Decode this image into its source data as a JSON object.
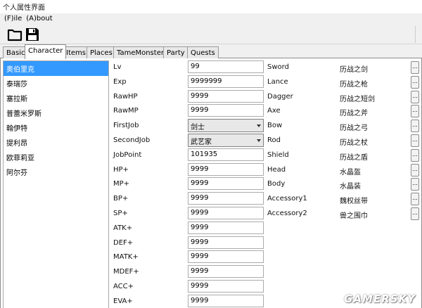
{
  "window": {
    "title": "个人属性界面"
  },
  "menu": [
    {
      "label": "(F)ile"
    },
    {
      "label": "(A)bout"
    }
  ],
  "toolbar": {
    "open_icon": "folder-icon",
    "save_icon": "floppy-disk-icon"
  },
  "tabs": [
    {
      "label": "Basic"
    },
    {
      "label": "Character",
      "active": true
    },
    {
      "label": "Items"
    },
    {
      "label": "Places"
    },
    {
      "label": "TameMonster"
    },
    {
      "label": "Party"
    },
    {
      "label": "Quests"
    }
  ],
  "characters": [
    {
      "name": "奥伯里克",
      "selected": true
    },
    {
      "name": "泰瑞莎"
    },
    {
      "name": "塞拉斯"
    },
    {
      "name": "普蕾米罗斯"
    },
    {
      "name": "翰伊特"
    },
    {
      "name": "提利昂"
    },
    {
      "name": "欧菲莉亚"
    },
    {
      "name": "阿尔芬"
    }
  ],
  "stats": [
    {
      "label": "Lv",
      "value": "99",
      "kind": "text"
    },
    {
      "label": "Exp",
      "value": "9999999",
      "kind": "text"
    },
    {
      "label": "RawHP",
      "value": "9999",
      "kind": "text"
    },
    {
      "label": "RawMP",
      "value": "9999",
      "kind": "text"
    },
    {
      "label": "FirstJob",
      "value": "剑士",
      "kind": "combo"
    },
    {
      "label": "SecondJob",
      "value": "武艺家",
      "kind": "combo"
    },
    {
      "label": "JobPoint",
      "value": "101935",
      "kind": "text"
    },
    {
      "label": "HP+",
      "value": "9999",
      "kind": "text"
    },
    {
      "label": "MP+",
      "value": "9999",
      "kind": "text"
    },
    {
      "label": "BP+",
      "value": "9999",
      "kind": "text"
    },
    {
      "label": "SP+",
      "value": "9999",
      "kind": "text"
    },
    {
      "label": "ATK+",
      "value": "9999",
      "kind": "text"
    },
    {
      "label": "DEF+",
      "value": "9999",
      "kind": "text"
    },
    {
      "label": "MATK+",
      "value": "9999",
      "kind": "text"
    },
    {
      "label": "MDEF+",
      "value": "9999",
      "kind": "text"
    },
    {
      "label": "ACC+",
      "value": "9999",
      "kind": "text"
    },
    {
      "label": "EVA+",
      "value": "9999",
      "kind": "text"
    }
  ],
  "equipment": [
    {
      "slot": "Sword",
      "item": "历战之剑"
    },
    {
      "slot": "Lance",
      "item": "历战之枪"
    },
    {
      "slot": "Dagger",
      "item": "历战之短剑"
    },
    {
      "slot": "Axe",
      "item": "历战之斧"
    },
    {
      "slot": "Bow",
      "item": "历战之弓"
    },
    {
      "slot": "Rod",
      "item": "历战之杖"
    },
    {
      "slot": "Shield",
      "item": "历战之盾"
    },
    {
      "slot": "Head",
      "item": "水晶盔"
    },
    {
      "slot": "Body",
      "item": "水晶装"
    },
    {
      "slot": "Accessory1",
      "item": "魏权丝带"
    },
    {
      "slot": "Accessory2",
      "item": "兽之围巾"
    }
  ],
  "browse_button_label": "...",
  "watermark": "GAMERSKY",
  "colors": {
    "selection": "#3399ff",
    "chrome": "#f0f0f0"
  }
}
